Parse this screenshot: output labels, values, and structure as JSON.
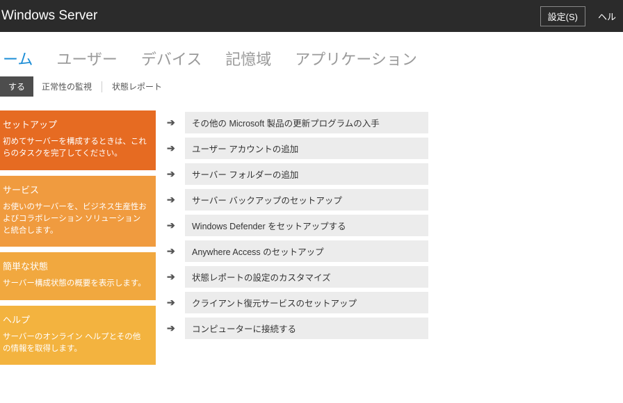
{
  "titlebar": {
    "title": "Windows Server",
    "settings": "設定(S)",
    "help": "ヘル"
  },
  "nav": {
    "items": [
      {
        "label": "ーム",
        "active": true
      },
      {
        "label": "ユーザー",
        "active": false
      },
      {
        "label": "デバイス",
        "active": false
      },
      {
        "label": "記憶域",
        "active": false
      },
      {
        "label": "アプリケーション",
        "active": false
      }
    ]
  },
  "subnav": {
    "items": [
      {
        "label": "する",
        "active": true
      },
      {
        "label": "正常性の監視",
        "active": false
      },
      {
        "label": "状態レポート",
        "active": false
      }
    ]
  },
  "cards": [
    {
      "title": "セットアップ",
      "desc": "初めてサーバーを構成するときは、これらのタスクを完了してください。",
      "tone": "orange-dark"
    },
    {
      "title": "サービス",
      "desc": "お使いのサーバーを、ビジネス生産性およびコラボレーション ソリューションと統合します。",
      "tone": "orange-a"
    },
    {
      "title": "簡単な状態",
      "desc": "サーバー構成状態の概要を表示します。",
      "tone": "orange-b"
    },
    {
      "title": "ヘルプ",
      "desc": "サーバーのオンライン ヘルプとその他の情報を取得します。",
      "tone": "orange-c"
    }
  ],
  "tasks": [
    {
      "label": "その他の Microsoft 製品の更新プログラムの入手"
    },
    {
      "label": "ユーザー アカウントの追加"
    },
    {
      "label": "サーバー フォルダーの追加"
    },
    {
      "label": "サーバー バックアップのセットアップ"
    },
    {
      "label": "Windows Defender をセットアップする"
    },
    {
      "label": "Anywhere Access のセットアップ"
    },
    {
      "label": "状態レポートの設定のカスタマイズ"
    },
    {
      "label": "クライアント復元サービスのセットアップ"
    },
    {
      "label": "コンピューターに接続する"
    }
  ]
}
